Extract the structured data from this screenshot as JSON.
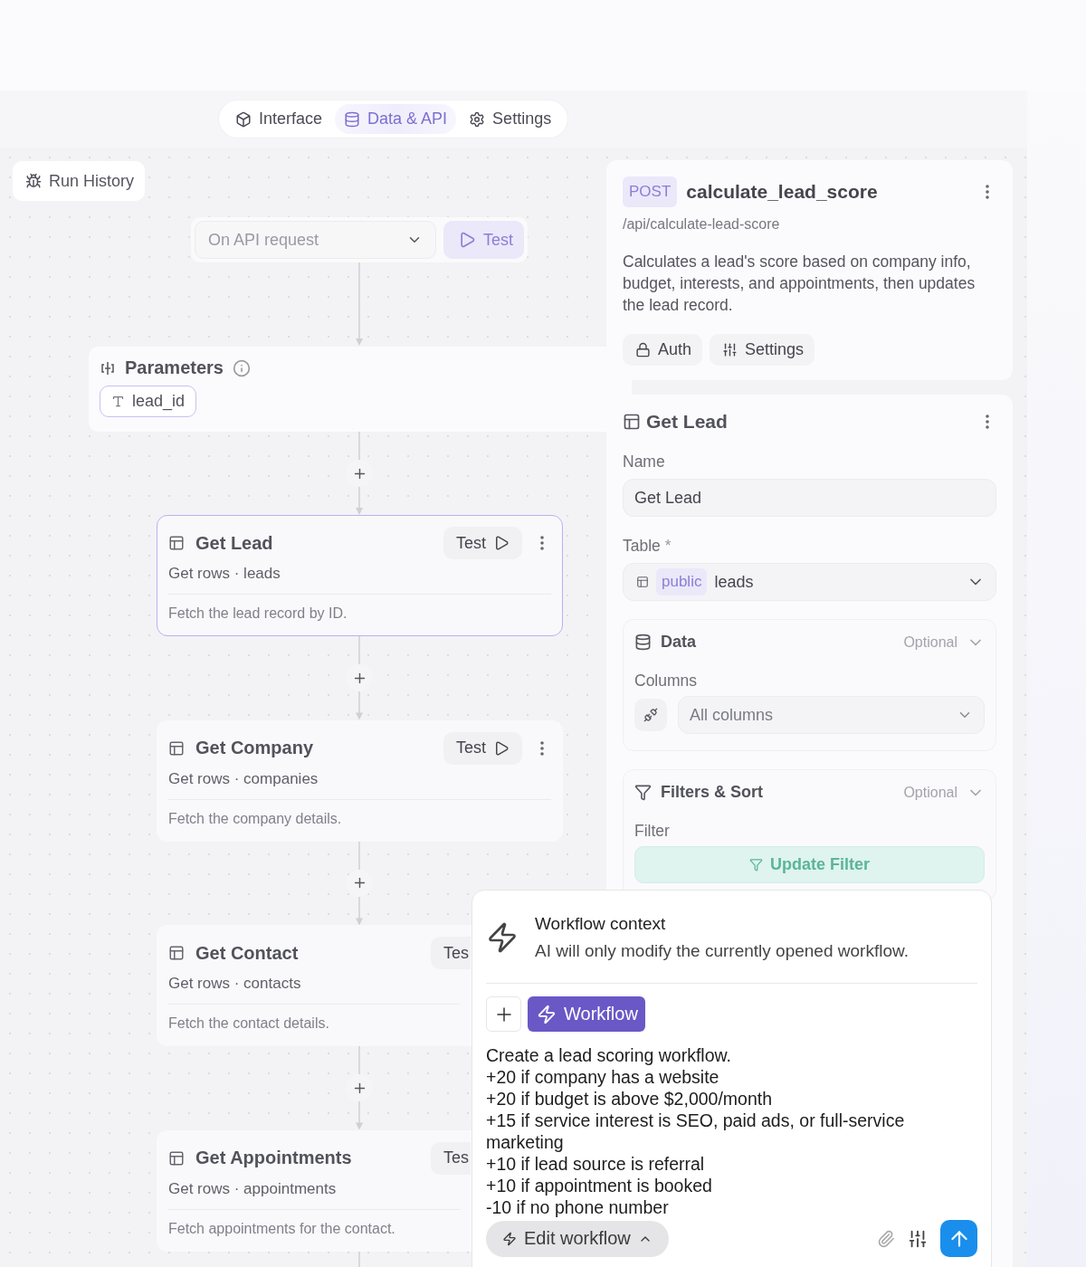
{
  "tabs": [
    {
      "label": "Interface",
      "selected": false
    },
    {
      "label": "Data & API",
      "selected": true
    },
    {
      "label": "Settings",
      "selected": false
    }
  ],
  "run_history": {
    "label": "Run History"
  },
  "trigger": {
    "value": "On API request",
    "test_label": "Test"
  },
  "parameters": {
    "title": "Parameters",
    "items": [
      "lead_id"
    ]
  },
  "nodes": [
    {
      "title": "Get Lead",
      "subtitle": "Get rows · leads",
      "description": "Fetch the lead record by ID.",
      "test_label": "Test",
      "selected": true,
      "clipped": false
    },
    {
      "title": "Get Company",
      "subtitle": "Get rows · companies",
      "description": "Fetch the company details.",
      "test_label": "Test",
      "selected": false,
      "clipped": false
    },
    {
      "title": "Get Contact",
      "subtitle": "Get rows · contacts",
      "description": "Fetch the contact details.",
      "test_label": "Tes",
      "selected": false,
      "clipped": true
    },
    {
      "title": "Get Appointments",
      "subtitle": "Get rows · appointments",
      "description": "Fetch appointments for the contact.",
      "test_label": "Tes",
      "selected": false,
      "clipped": true
    }
  ],
  "endpoint": {
    "method": "POST",
    "name": "calculate_lead_score",
    "path": "/api/calculate-lead-score",
    "description": "Calculates a lead's score based on company info, budget, interests, and appointments, then updates the lead record.",
    "buttons": [
      {
        "label": "Auth"
      },
      {
        "label": "Settings"
      }
    ]
  },
  "step_panel": {
    "title": "Get Lead",
    "name_label": "Name",
    "name_value": "Get Lead",
    "table_label": "Table",
    "required_mark": "*",
    "schema": "public",
    "table": "leads",
    "sections": [
      {
        "kind": "columns",
        "title": "Data",
        "optional": "Optional",
        "field_label": "Columns",
        "value": "All columns"
      },
      {
        "kind": "filter",
        "title": "Filters & Sort",
        "optional": "Optional",
        "field_label": "Filter",
        "button": "Update Filter"
      }
    ]
  },
  "chat": {
    "context_title": "Workflow context",
    "context_text": "AI will only modify the currently opened workflow.",
    "chip": "Workflow",
    "message": "Create a lead scoring workflow.\n+20 if company has a website\n+20 if budget is above $2,000/month\n+15 if service interest is SEO, paid ads, or full-service marketing\n+10 if lead source is referral\n+10 if appointment is booked\n-10 if no phone number",
    "mode": "Edit workflow"
  }
}
